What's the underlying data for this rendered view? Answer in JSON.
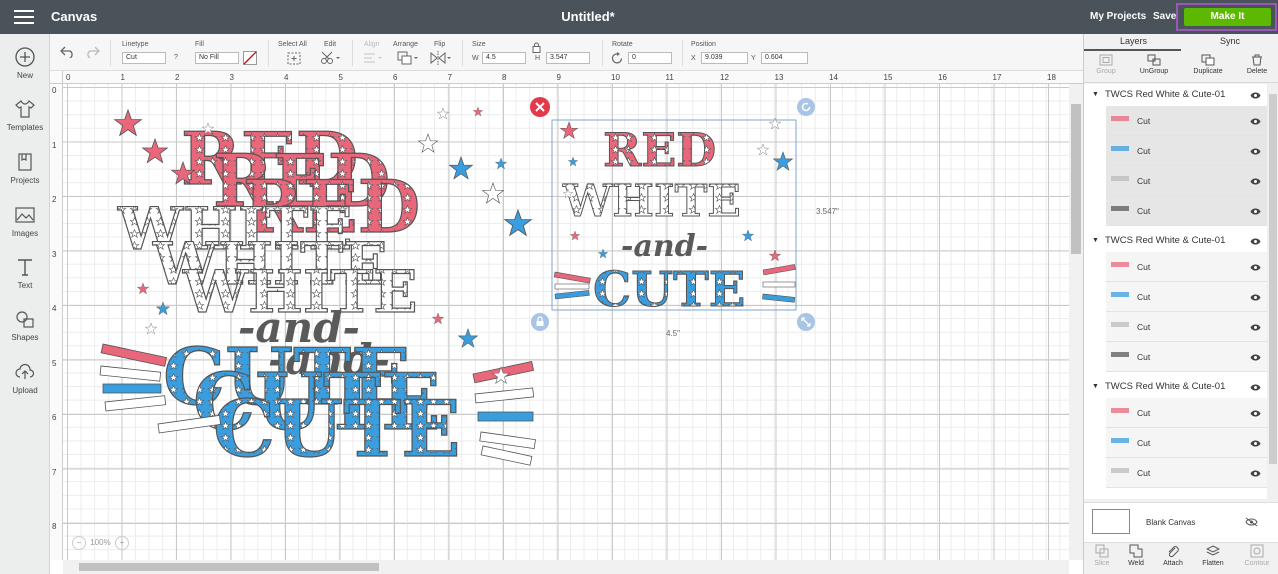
{
  "topbar": {
    "app_title": "Canvas",
    "doc_title": "Untitled*",
    "my_projects": "My Projects",
    "save": "Save",
    "make_it": "Make It",
    "make_it_color": "#5cb800"
  },
  "leftnav": [
    {
      "label": "New",
      "icon": "plus-circle-icon"
    },
    {
      "label": "Templates",
      "icon": "shirt-icon"
    },
    {
      "label": "Projects",
      "icon": "projects-icon"
    },
    {
      "label": "Images",
      "icon": "image-icon"
    },
    {
      "label": "Text",
      "icon": "text-icon"
    },
    {
      "label": "Shapes",
      "icon": "shapes-icon"
    },
    {
      "label": "Upload",
      "icon": "upload-icon"
    }
  ],
  "toolbar": {
    "linetype_label": "Linetype",
    "linetype_value": "Cut",
    "help": "?",
    "fill_label": "Fill",
    "fill_value": "No Fill",
    "select_all": "Select All",
    "edit": "Edit",
    "align": "Align",
    "arrange": "Arrange",
    "flip": "Flip",
    "size_label": "Size",
    "w_label": "W",
    "w_value": "4.5",
    "h_label": "H",
    "h_value": "3.547",
    "rotate_label": "Rotate",
    "rotate_value": "0",
    "position_label": "Position",
    "x_label": "X",
    "x_value": "9.039",
    "y_label": "Y",
    "y_value": "0.604"
  },
  "ruler": {
    "h": [
      "0",
      "1",
      "2",
      "3",
      "4",
      "5",
      "6",
      "7",
      "8",
      "9",
      "10",
      "11",
      "12",
      "13",
      "14",
      "15",
      "16",
      "17",
      "18"
    ],
    "v": [
      "0",
      "1",
      "2",
      "3",
      "4",
      "5",
      "6",
      "7",
      "8"
    ]
  },
  "canvas": {
    "width_label": "4.5\"",
    "height_label": "3.547\"",
    "zoom": "100%",
    "word_red": "RED",
    "word_white": "WHITE",
    "word_and": "-and-",
    "word_cute": "CUTE"
  },
  "colors": {
    "red": "#e8677a",
    "blue": "#3a9ede",
    "gray": "#5a5a5a",
    "selection": "#7da6d6"
  },
  "rpanel": {
    "tab_layers": "Layers",
    "tab_sync": "Sync",
    "tools": [
      {
        "label": "Group",
        "enabled": false
      },
      {
        "label": "UnGroup",
        "enabled": true
      },
      {
        "label": "Duplicate",
        "enabled": true
      },
      {
        "label": "Delete",
        "enabled": true
      }
    ],
    "groups": [
      {
        "name": "TWCS Red White & Cute-01",
        "layers": [
          "Cut",
          "Cut",
          "Cut",
          "Cut"
        ]
      },
      {
        "name": "TWCS Red White & Cute-01",
        "layers": [
          "Cut",
          "Cut",
          "Cut",
          "Cut"
        ]
      },
      {
        "name": "TWCS Red White & Cute-01",
        "layers": [
          "Cut",
          "Cut",
          "Cut"
        ]
      }
    ],
    "blank_canvas": "Blank Canvas",
    "bottom_tools": [
      {
        "label": "Slice",
        "enabled": false
      },
      {
        "label": "Weld",
        "enabled": true
      },
      {
        "label": "Attach",
        "enabled": true
      },
      {
        "label": "Flatten",
        "enabled": true
      },
      {
        "label": "Contour",
        "enabled": false
      }
    ]
  }
}
